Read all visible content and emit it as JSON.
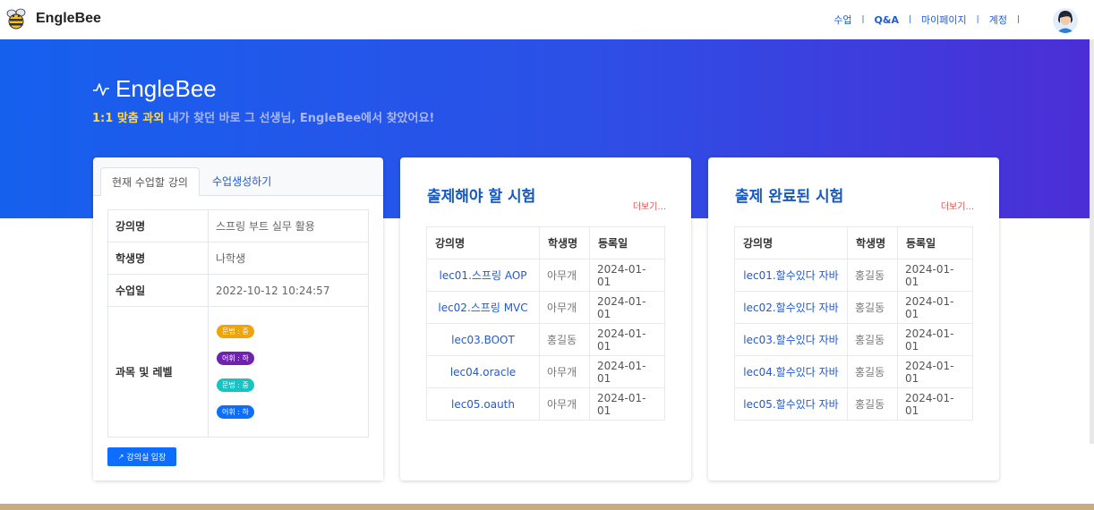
{
  "navbar": {
    "brand": "EngleBee",
    "links": [
      "수업",
      "Q&A",
      "마이페이지",
      "계정"
    ],
    "separator": "|"
  },
  "hero": {
    "title": "EngleBee",
    "subtitle_highlight": "1:1 맞춤 과외",
    "subtitle_rest": " 내가 찾던 바로 그 선생님, EngleBee에서 찾았어요!"
  },
  "lesson_card": {
    "tabs": [
      "현재 수업할 강의",
      "수업생성하기"
    ],
    "rows": [
      {
        "label": "강의명",
        "value": "스프링 부트 실무 활용"
      },
      {
        "label": "학생명",
        "value": "나학생"
      },
      {
        "label": "수업일",
        "value": "2022-10-12 10:24:57"
      }
    ],
    "subject_label": "과목 및 레벨",
    "badges": [
      {
        "text": "문법 : 중",
        "color": "#f0a30a"
      },
      {
        "text": "어휘 : 하",
        "color": "#6f22b0"
      },
      {
        "text": "문법 : 중",
        "color": "#17c3c3"
      },
      {
        "text": "어휘 : 하",
        "color": "#0d6efd"
      }
    ],
    "enter_button": "강의실 입장"
  },
  "pending_exams": {
    "title": "출제해야 할 시험",
    "more": "더보기...",
    "headers": [
      "강의명",
      "학생명",
      "등록일"
    ],
    "rows": [
      [
        "lec01.스프링 AOP",
        "아무개",
        "2024-01-01"
      ],
      [
        "lec02.스프링 MVC",
        "아무개",
        "2024-01-01"
      ],
      [
        "lec03.BOOT",
        "홍길동",
        "2024-01-01"
      ],
      [
        "lec04.oracle",
        "아무개",
        "2024-01-01"
      ],
      [
        "lec05.oauth",
        "아무개",
        "2024-01-01"
      ]
    ]
  },
  "done_exams": {
    "title": "출제 완료된 시험",
    "more": "더보기...",
    "headers": [
      "강의명",
      "학생명",
      "등록일"
    ],
    "rows": [
      [
        "lec01.할수있다 자바",
        "홍길동",
        "2024-01-01"
      ],
      [
        "lec02.할수있다 자바",
        "홍길동",
        "2024-01-01"
      ],
      [
        "lec03.할수있다 자바",
        "홍길동",
        "2024-01-01"
      ],
      [
        "lec04.할수있다 자바",
        "홍길동",
        "2024-01-01"
      ],
      [
        "lec05.할수있다 자바",
        "홍길동",
        "2024-01-01"
      ]
    ]
  },
  "colors": {
    "accent": "#1e5bd6",
    "hero_start": "#1660ee",
    "hero_end": "#4b2ed6",
    "highlight": "#ffd84a",
    "more_link": "#d9534f"
  }
}
